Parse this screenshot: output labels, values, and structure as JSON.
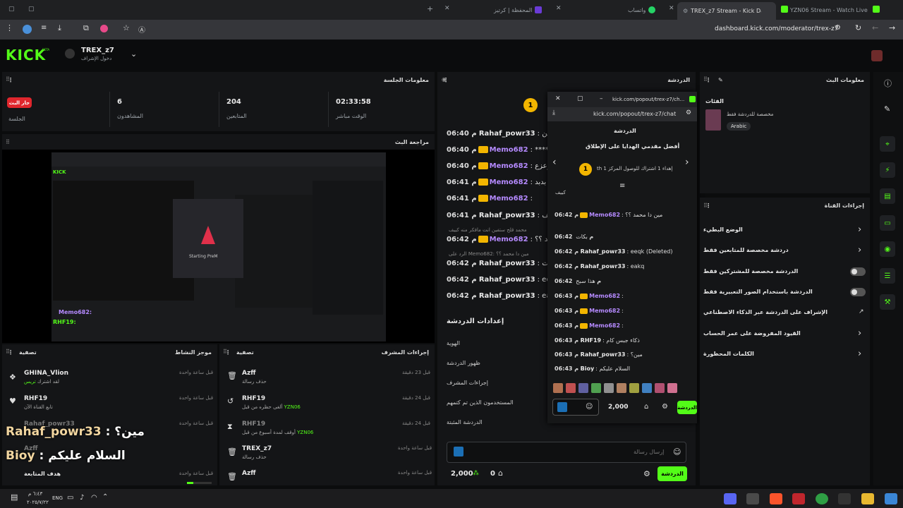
{
  "browser": {
    "tabs": [
      {
        "label": "المحفظة | كرتيز"
      },
      {
        "label": "واتساب"
      },
      {
        "label": "TREX_z7 Stream - Kick Das"
      },
      {
        "label": "YZN06 Stream - Watch Live on"
      }
    ],
    "url": "dashboard.kick.com/moderator/trex-z7"
  },
  "header": {
    "logo": "KICK",
    "logo_beta": "BETA",
    "channel_name": "TREX_z7",
    "channel_sub": "دخول الإشراف"
  },
  "session": {
    "title": "معلومات الجلسة",
    "live_badge": "جار البث",
    "live_label": "الجلسة",
    "viewers_value": "6",
    "viewers_label": "المشاهدون",
    "followers_value": "204",
    "followers_label": "المتابعين",
    "time_value": "02:33:58",
    "time_label": "الوقت مباشر"
  },
  "preview": {
    "title": "مراجعة البث",
    "starting_text": "Starting PreM",
    "chat_lines": [
      "Memo682:",
      "RHF19:"
    ]
  },
  "activity": {
    "title": "موجز النشاط",
    "filter": "تصفية",
    "items": [
      {
        "user": "GHINA_Vlion",
        "desc": "لقد اشترك",
        "extra": "تريس",
        "time": "قبل ساعة واحدة"
      },
      {
        "user": "RHF19",
        "desc": "تابع القناة الآن",
        "time": "قبل ساعة واحدة"
      },
      {
        "user": "Rahaf_powr33",
        "desc": "",
        "time": "قبل ساعة واحدة"
      },
      {
        "user": "Azff",
        "desc": "",
        "time": ""
      },
      {
        "user": "هدف المتابعة",
        "desc": "",
        "time": "قبل ساعة واحدة"
      }
    ]
  },
  "overlay": {
    "line1_user": "Rahaf_powr33",
    "line1_text": ": مين؟",
    "line2_user": "Bioy",
    "line2_text": ": السلام عليكم"
  },
  "modactions": {
    "title": "إجراءات المشرف",
    "filter": "تصفية",
    "items": [
      {
        "user": "Azff",
        "desc": "حذف رسالة",
        "time": "قبل 23 دقيقة"
      },
      {
        "user": "RHF19",
        "desc": "ألغى حظره من قبل",
        "extra": "YZN06",
        "time": "قبل 24 دقيقة"
      },
      {
        "user": "RHF19",
        "desc": "أوقف لمدة أسبوع من قبل",
        "extra": "YZN06",
        "time": "قبل 24 دقيقة"
      },
      {
        "user": "TREX_z7",
        "desc": "حذف رسالة",
        "time": "قبل ساعة واحدة"
      },
      {
        "user": "Azff",
        "desc": "",
        "time": "قبل ساعة واحدة"
      }
    ]
  },
  "chat": {
    "title": "الدردشة",
    "pinned_badge": "1",
    "messages": [
      {
        "time": "06:40 م",
        "user": "Rahaf_powr33",
        "color": "gold",
        "text": ": يا امين"
      },
      {
        "time": "06:40 م",
        "user": "Memo682",
        "color": "purple",
        "text": ": ******"
      },
      {
        "time": "06:40 م",
        "user": "Memo682",
        "color": "purple",
        "text": ": زعزع"
      },
      {
        "time": "06:41 م",
        "user": "Memo682",
        "color": "purple",
        "text": ": نعود بدبد"
      },
      {
        "time": "06:41 م",
        "user": "Memo682",
        "color": "purple",
        "text": ":"
      },
      {
        "time": "06:41 م",
        "user": "Rahaf_powr33",
        "color": "gold",
        "text": ": كييف"
      },
      {
        "time": "06:42 م",
        "user": "Memo682",
        "color": "purple",
        "text": ": محمد ؟؟"
      },
      {
        "time": "06:42 م",
        "user": "Rahaf_powr33",
        "color": "gold",
        "text": ": بكات"
      },
      {
        "time": "06:42 م",
        "user": "Rahaf_powr33",
        "color": "gold",
        "text": ": eeqk"
      },
      {
        "time": "06:42 م",
        "user": "Rahaf_powr33",
        "color": "gold",
        "text": ": eakq"
      }
    ],
    "reply1": "محمد قلح ستفين انت مافكر منه كييف",
    "reply2": "الرد على Memo682: مين دا محمد ؟؟",
    "settings_title": "إعدادات الدردشة",
    "settings": [
      "الهوية",
      "ظهور الدردشة",
      "إجراءات المشرف",
      "المستخدمون الذين تم كتمهم",
      "الدردشة المثبتة"
    ],
    "input_placeholder": "إرسال رسالة",
    "points": "2,000",
    "count": "0",
    "send": "الدردشة"
  },
  "popout": {
    "url_title": "kick.com/popout/trex-z7/ch...",
    "url": "kick.com/popout/trex-z7/chat",
    "title": "الدردشة",
    "gifters_title": "أفضل مقدمي الهدايا على الإطلاق",
    "gifter_rank": "1",
    "gifter_text": "th إهداء 1 اشتراك للوصول المركز 1",
    "pin_text": "كييف",
    "messages": [
      {
        "time": "06:42 م",
        "user": "Memo682",
        "color": "purple",
        "text": ": مين دا محمد ؟؟"
      },
      {
        "time": "06:42 م",
        "user": "",
        "color": "gold",
        "text": "بكات"
      },
      {
        "time": "06:42 م",
        "user": "Rahaf_powr33",
        "color": "gold",
        "text": ": eeqk (Deleted)"
      },
      {
        "time": "06:42 م",
        "user": "Rahaf_powr33",
        "color": "gold",
        "text": ": eakq"
      },
      {
        "time": "06:42 م",
        "user": "",
        "color": "gold",
        "text": "هذا سبح"
      },
      {
        "time": "06:43 م",
        "user": "Memo682",
        "color": "purple",
        "text": ":"
      },
      {
        "time": "06:43 م",
        "user": "Memo682",
        "color": "purple",
        "text": ":"
      },
      {
        "time": "06:43 م",
        "user": "Memo682",
        "color": "purple",
        "text": ":"
      },
      {
        "time": "06:43 م",
        "user": "RHF19",
        "color": "gold",
        "text": ": ذكاء جبس كام"
      },
      {
        "time": "06:43 م",
        "user": "Rahaf_powr33",
        "color": "gold",
        "text": ": مين؟"
      },
      {
        "time": "06:43 م",
        "user": "Bioy",
        "color": "gold",
        "text": ": السلام عليكم"
      }
    ],
    "points": "2,000",
    "send": "الدردشة"
  },
  "streaminfo": {
    "title": "معلومات البث",
    "category_label": "الفئات",
    "desc": "مخصصة للدردشة فقط",
    "tag": "Arabic"
  },
  "channelactions": {
    "title": "إجراءات القناة",
    "items": [
      {
        "label": "الوضع البطيء",
        "control": "chevron"
      },
      {
        "label": "دردشة مخصصة للمتابعين فقط",
        "control": "chevron"
      },
      {
        "label": "الدردشة مخصصة للمشتركين فقط",
        "control": "toggle"
      },
      {
        "label": "الدردشة باستخدام الصور التعبيرية فقط",
        "control": "toggle"
      },
      {
        "label": "الإشراف على الدردشة عبر الذكاء الاصطناعي",
        "control": "external"
      },
      {
        "label": "القيود المفروضة على عمر الحساب",
        "control": "chevron"
      },
      {
        "label": "الكلمات المحظورة",
        "control": "chevron"
      }
    ]
  },
  "taskbar": {
    "time": "٦:٤٣ م",
    "date": "٢٠٢٥/٧/٢٢",
    "lang": "ENG"
  },
  "colors": {
    "accent": "#53fc18",
    "purple": "#b58aff",
    "live_red": "#e0262d",
    "gold": "#f2b500"
  }
}
